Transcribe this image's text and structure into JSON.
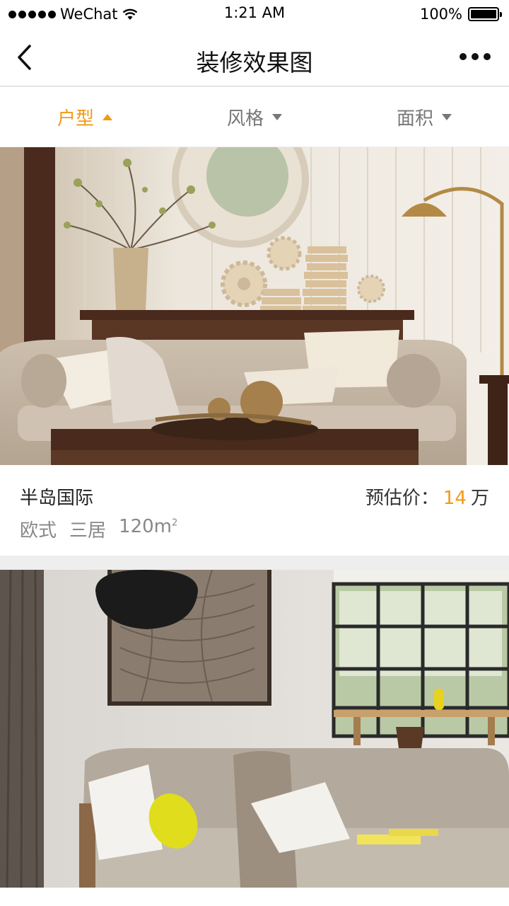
{
  "status_bar": {
    "carrier": "WeChat",
    "time": "1:21 AM",
    "battery": "100%",
    "battery_level": 1.0
  },
  "nav": {
    "title": "装修效果图",
    "back_icon": "chevron-left-icon",
    "more_icon": "more-dots-icon"
  },
  "filters": [
    {
      "label": "户型",
      "active": true
    },
    {
      "label": "风格",
      "active": false
    },
    {
      "label": "面积",
      "active": false
    }
  ],
  "cards": [
    {
      "name": "半岛国际",
      "style": "欧式",
      "rooms": "三居",
      "area": "120m",
      "area_unit_sup": "2",
      "price_label": "预估价：",
      "price_value": "14",
      "price_unit": "万"
    }
  ],
  "colors": {
    "accent": "#f29a15",
    "muted": "#888888"
  }
}
